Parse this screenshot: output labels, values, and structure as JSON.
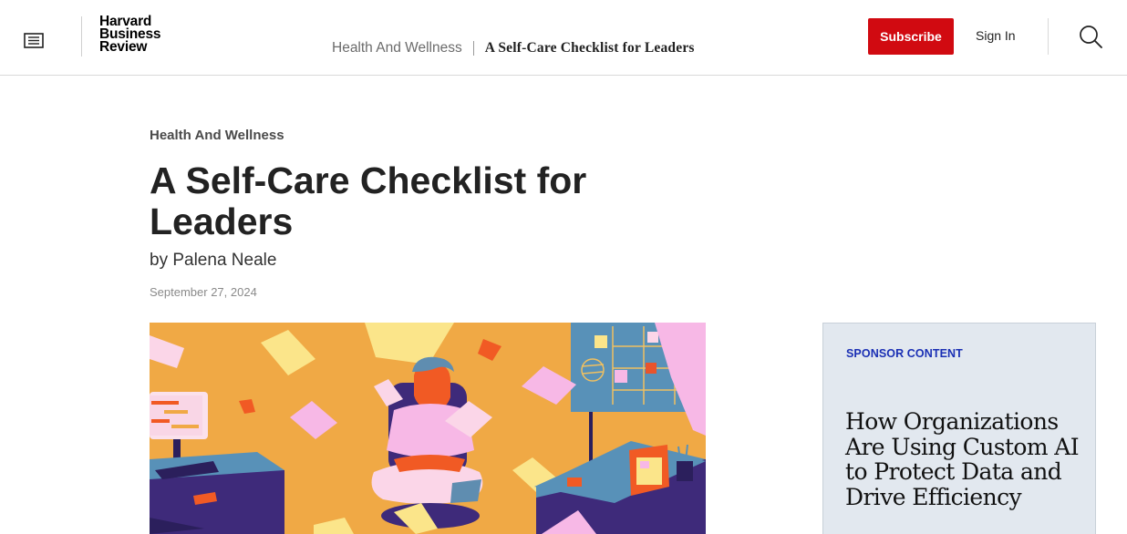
{
  "header": {
    "logo_lines": [
      "Harvard",
      "Business",
      "Review"
    ],
    "breadcrumb_category": "Health And Wellness",
    "breadcrumb_title": "A Self-Care Checklist for Leaders",
    "subscribe_label": "Subscribe",
    "signin_label": "Sign In",
    "icons": [
      "menu-icon",
      "search-icon"
    ]
  },
  "article": {
    "category": "Health And Wellness",
    "title": "A Self-Care Checklist for Leaders",
    "byline": "by Palena Neale",
    "date": "September 27, 2024"
  },
  "sponsor": {
    "label": "SPONSOR CONTENT",
    "title": "How Organizations Are Using Custom AI to Protect Data and Drive Efficiency"
  },
  "colors": {
    "brand_red": "#d10a11",
    "sponsor_bg": "#e2e8ef",
    "sponsor_label": "#1a2fb4"
  }
}
